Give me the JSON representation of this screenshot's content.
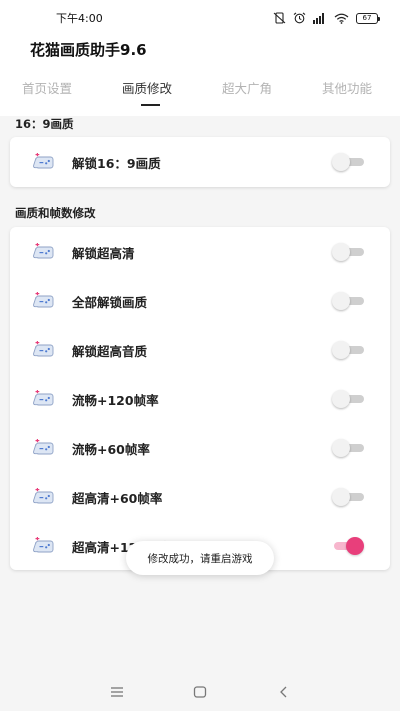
{
  "status_bar": {
    "time": "下午4:00",
    "battery": "67",
    "icons": [
      "vibrate-off-icon",
      "alarm-icon",
      "signal-icon",
      "wifi-icon",
      "battery-icon"
    ]
  },
  "header": {
    "title": "花猫画质助手9.6",
    "tabs": [
      {
        "label": "首页设置",
        "active": false
      },
      {
        "label": "画质修改",
        "active": true
      },
      {
        "label": "超大广角",
        "active": false
      },
      {
        "label": "其他功能",
        "active": false
      }
    ]
  },
  "sections": [
    {
      "title": "16：9画质",
      "items": [
        {
          "label": "解锁16：9画质",
          "enabled": false,
          "icon": "gamepad-icon"
        }
      ]
    },
    {
      "title": "画质和帧数修改",
      "items": [
        {
          "label": "解锁超高清",
          "enabled": false,
          "icon": "gamepad-icon"
        },
        {
          "label": "全部解锁画质",
          "enabled": false,
          "icon": "gamepad-icon"
        },
        {
          "label": "解锁超高音质",
          "enabled": false,
          "icon": "gamepad-icon"
        },
        {
          "label": "流畅+120帧率",
          "enabled": false,
          "icon": "gamepad-icon"
        },
        {
          "label": "流畅+60帧率",
          "enabled": false,
          "icon": "gamepad-icon"
        },
        {
          "label": "超高清+60帧率",
          "enabled": false,
          "icon": "gamepad-icon"
        },
        {
          "label": "超高清+120帧率",
          "enabled": true,
          "icon": "gamepad-icon"
        }
      ]
    }
  ],
  "toast": {
    "message": "修改成功，请重启游戏"
  },
  "nav_bar": {
    "buttons": [
      "menu-icon",
      "home-icon",
      "back-icon"
    ]
  },
  "colors": {
    "accent": "#e83f7b",
    "accent_light": "#f7b6cd",
    "toggle_off": "#cfcfcf",
    "background": "#f5f5f5",
    "card": "#ffffff"
  }
}
